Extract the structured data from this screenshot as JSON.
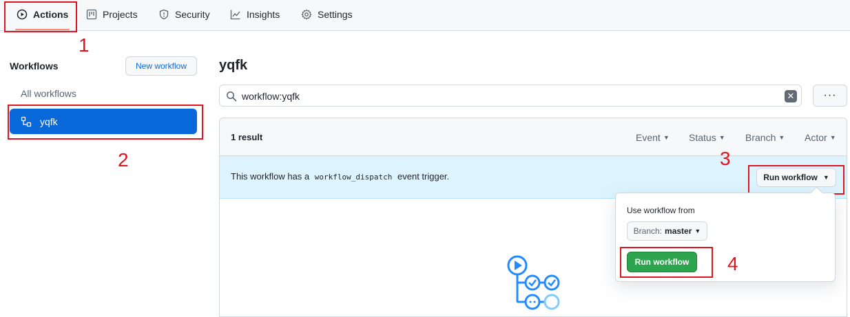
{
  "nav": {
    "tabs": [
      {
        "label": "Actions",
        "icon": "play-icon"
      },
      {
        "label": "Projects",
        "icon": "project-icon"
      },
      {
        "label": "Security",
        "icon": "shield-icon"
      },
      {
        "label": "Insights",
        "icon": "graph-icon"
      },
      {
        "label": "Settings",
        "icon": "gear-icon"
      }
    ]
  },
  "annotations": [
    "1",
    "2",
    "3",
    "4"
  ],
  "sidebar": {
    "title": "Workflows",
    "new_workflow_label": "New workflow",
    "all_workflows_label": "All workflows",
    "selected_workflow": "yqfk"
  },
  "main": {
    "title": "yqfk",
    "search_value": "workflow:yqfk",
    "kebab_label": "···",
    "results_count": "1 result",
    "filters": [
      "Event",
      "Status",
      "Branch",
      "Actor"
    ],
    "banner": {
      "prefix": "This workflow has a",
      "code": "workflow_dispatch",
      "suffix": "event trigger."
    },
    "run_workflow_label": "Run workflow"
  },
  "dropdown": {
    "label": "Use workflow from",
    "branch_prefix": "Branch:",
    "branch_value": "master",
    "run_label": "Run workflow"
  },
  "colors": {
    "accent_blue": "#0969da",
    "banner_bg": "#ddf4ff",
    "run_green": "#2da44e",
    "annotation_red": "#e0141e",
    "active_tab_underline": "#fd8c73"
  }
}
